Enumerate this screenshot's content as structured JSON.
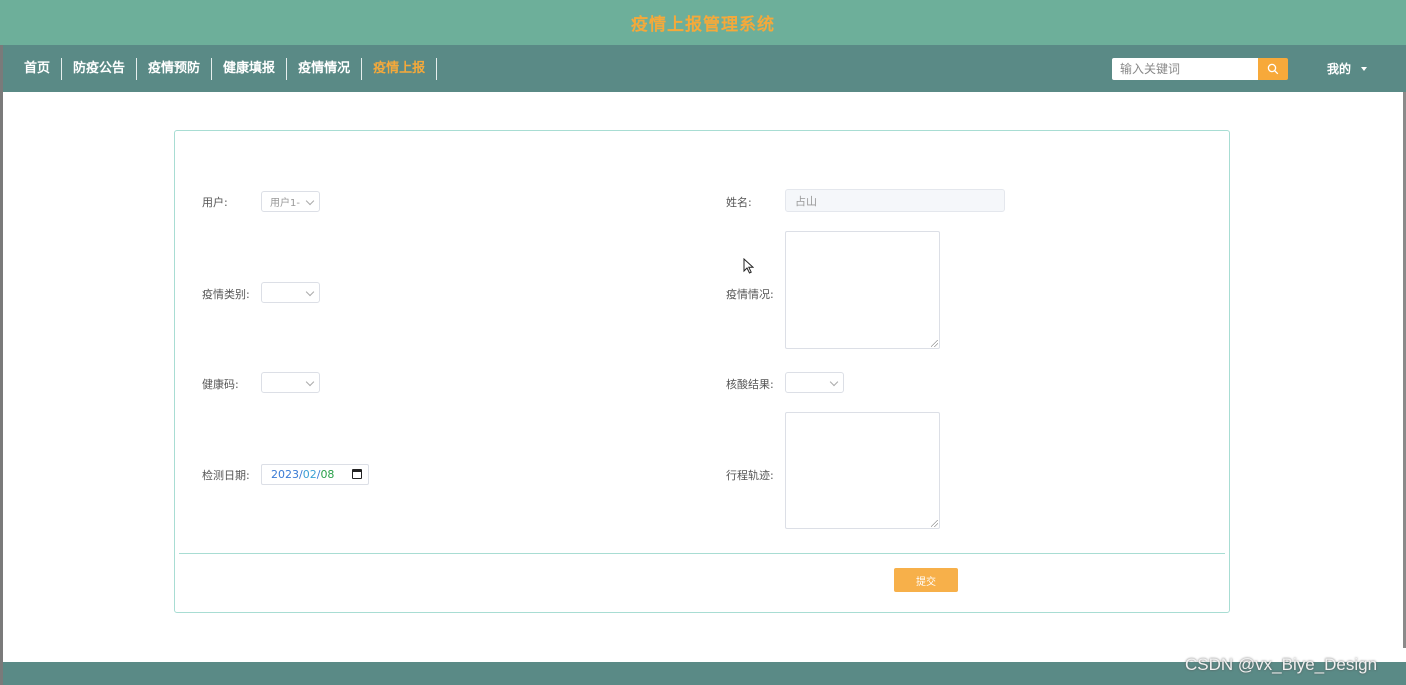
{
  "header": {
    "title": "疫情上报管理系统"
  },
  "nav": {
    "items": [
      {
        "label": "首页"
      },
      {
        "label": "防疫公告"
      },
      {
        "label": "疫情预防"
      },
      {
        "label": "健康填报"
      },
      {
        "label": "疫情情况"
      },
      {
        "label": "疫情上报"
      }
    ],
    "active_index": 5,
    "search": {
      "placeholder": "输入关键词",
      "icon": "search-icon"
    },
    "user_menu": {
      "label": "我的",
      "icon": "caret-down-icon"
    }
  },
  "form": {
    "user": {
      "label": "用户:",
      "value": "用户1-"
    },
    "name": {
      "label": "姓名:",
      "value": "占山"
    },
    "category": {
      "label": "疫情类别:",
      "value": ""
    },
    "situation": {
      "label": "疫情情况:",
      "value": ""
    },
    "health_code": {
      "label": "健康码:",
      "value": ""
    },
    "nucleic_result": {
      "label": "核酸结果:",
      "value": ""
    },
    "test_date": {
      "label": "检测日期:",
      "year": "2023",
      "month": "02",
      "day": "08",
      "sep": "/",
      "icon": "calendar-icon"
    },
    "itinerary": {
      "label": "行程轨迹:",
      "value": ""
    },
    "submit_label": "提交"
  },
  "watermark": "CSDN @vx_Biye_Design",
  "colors": {
    "topbar": "#6daf9a",
    "navbar": "#5a8a86",
    "accent": "#f5a93a",
    "card_border": "#a8ddd3"
  }
}
